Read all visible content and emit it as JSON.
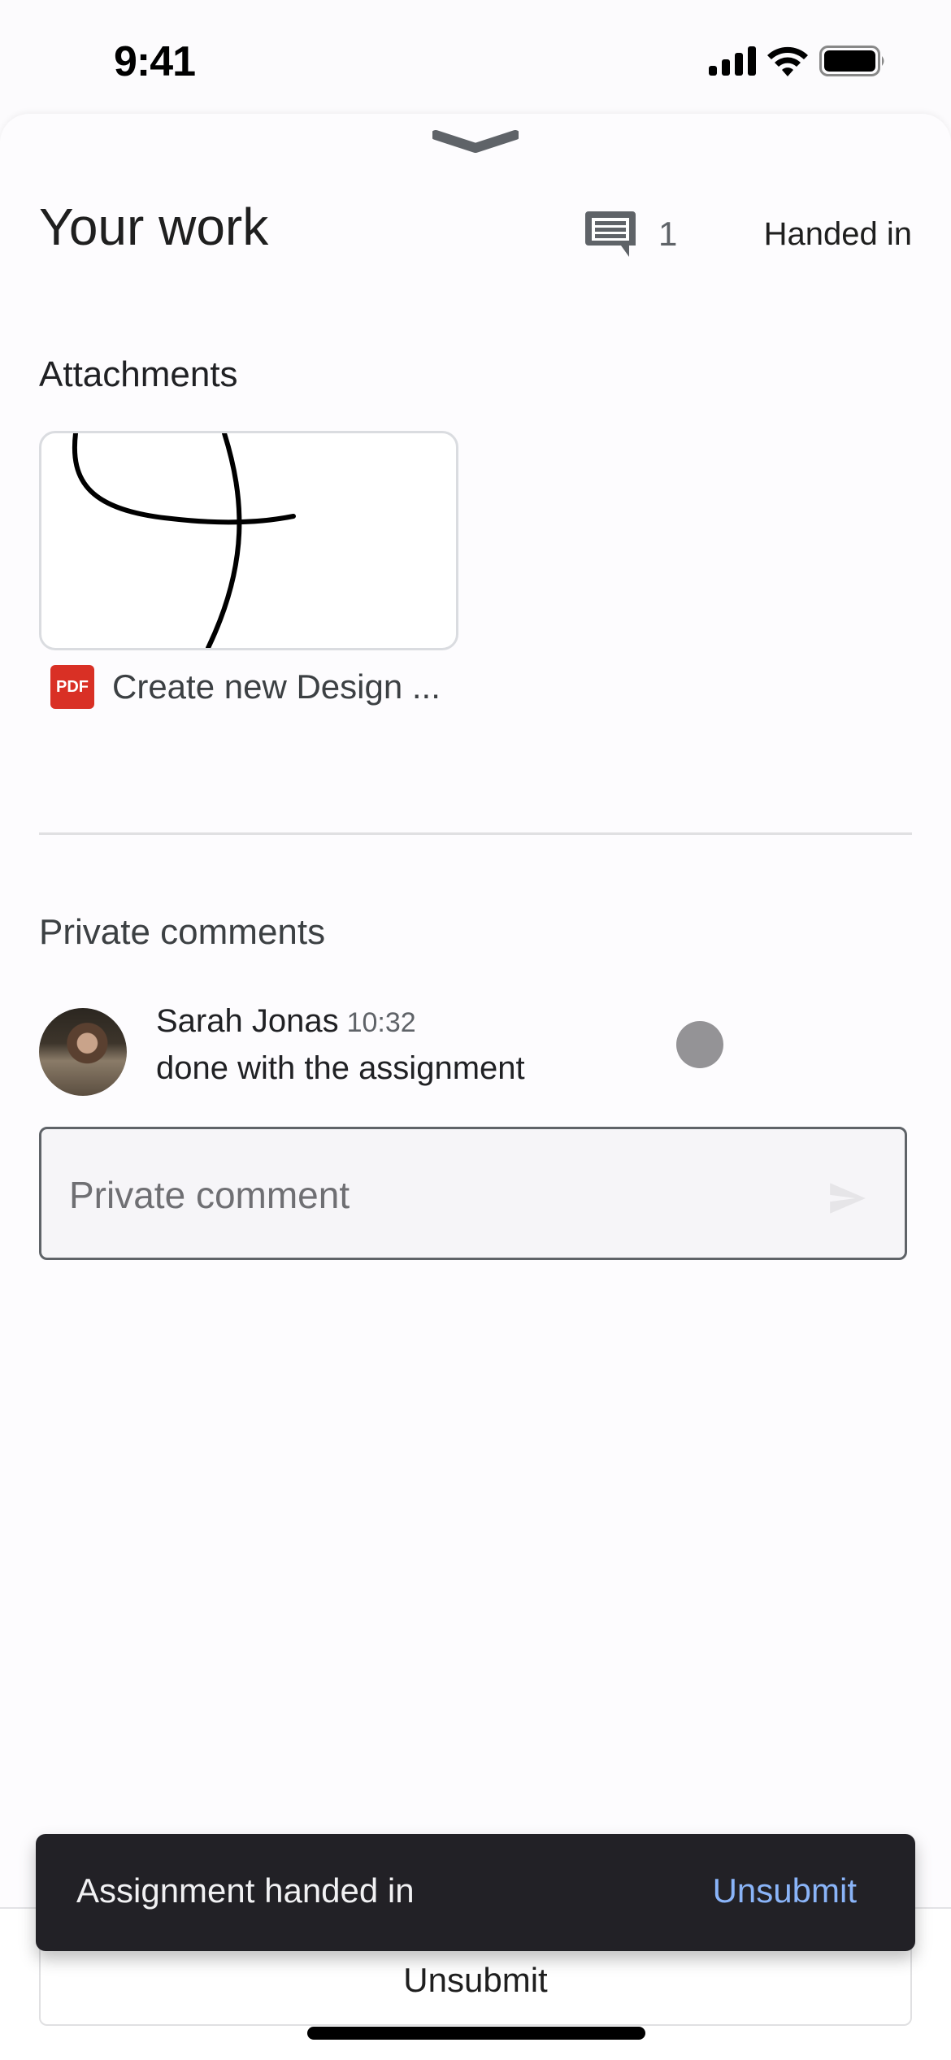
{
  "status_bar": {
    "time": "9:41",
    "icons": [
      "signal-icon",
      "wifi-icon",
      "battery-icon"
    ]
  },
  "header": {
    "title": "Your work",
    "comment_count": "1",
    "status": "Handed in"
  },
  "attachments": {
    "heading": "Attachments",
    "items": [
      {
        "type": "PDF",
        "type_label": "PDF",
        "name": "Create new Design ..."
      }
    ]
  },
  "private_comments": {
    "heading": "Private comments",
    "comments": [
      {
        "author": "Sarah Jonas",
        "time": "10:32",
        "text": "done with the assignment"
      }
    ],
    "input_placeholder": "Private comment"
  },
  "snackbar": {
    "message": "Assignment handed in",
    "action": "Unsubmit",
    "action_color": "#8ab4f8"
  },
  "footer": {
    "button_label": "Unsubmit"
  },
  "colors": {
    "pdf": "#d93025",
    "snackbar_bg": "#222126"
  }
}
